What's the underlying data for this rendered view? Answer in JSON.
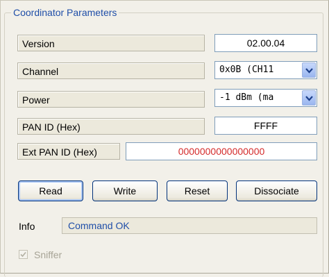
{
  "group": {
    "title": "Coordinator Parameters"
  },
  "fields": {
    "version": {
      "label": "Version",
      "value": "02.00.04"
    },
    "channel": {
      "label": "Channel",
      "value": "0x0B (CH11"
    },
    "power": {
      "label": "Power",
      "value": "-1 dBm (ma"
    },
    "pan_id": {
      "label": "PAN ID (Hex)",
      "value": "FFFF"
    },
    "ext_pan_id": {
      "label": "Ext PAN ID (Hex)",
      "value": "0000000000000000",
      "value_color": "#d42a2a"
    }
  },
  "buttons": {
    "read": "Read",
    "write": "Write",
    "reset": "Reset",
    "dissociate": "Dissociate"
  },
  "info": {
    "label": "Info",
    "value": "Command OK"
  },
  "sniffer": {
    "label": "Sniffer",
    "checked": true,
    "enabled": false
  },
  "colors": {
    "accent": "#1f4ea8",
    "error_value": "#d42a2a",
    "background": "#f2f0e9"
  },
  "icons": {
    "dropdown": "chevron-down-icon",
    "check": "checkmark-icon"
  }
}
